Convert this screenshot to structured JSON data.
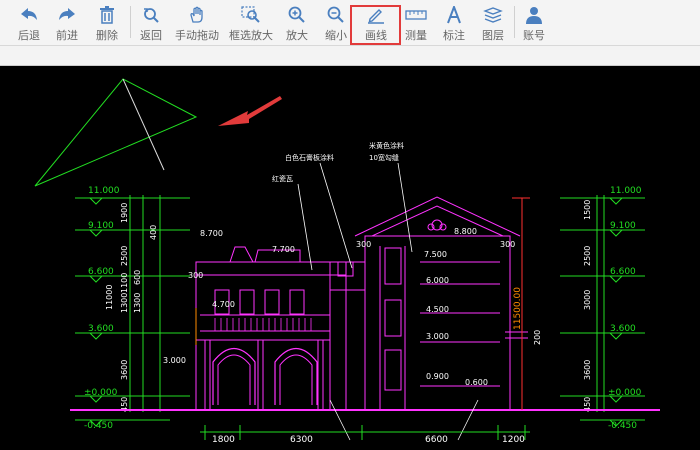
{
  "toolbar": {
    "items": [
      {
        "label": "后退",
        "icon": "arrow-left-icon"
      },
      {
        "label": "前进",
        "icon": "arrow-right-icon"
      },
      {
        "label": "删除",
        "icon": "trash-icon"
      },
      {
        "label": "返回",
        "icon": "zoom-back-icon"
      },
      {
        "label": "手动拖动",
        "icon": "hand-icon"
      },
      {
        "label": "框选放大",
        "icon": "box-zoom-icon"
      },
      {
        "label": "放大",
        "icon": "zoom-in-icon"
      },
      {
        "label": "缩小",
        "icon": "zoom-out-icon"
      },
      {
        "label": "画线",
        "icon": "pencil-icon"
      },
      {
        "label": "测量",
        "icon": "ruler-icon"
      },
      {
        "label": "标注",
        "icon": "text-a-icon"
      },
      {
        "label": "图层",
        "icon": "layers-icon"
      },
      {
        "label": "账号",
        "icon": "user-icon"
      }
    ],
    "highlighted": "画线",
    "highlight_color": "#e23b3b",
    "icon_color": "#4a7fbf"
  },
  "drawing": {
    "left_levels": [
      "11.000",
      "9.100",
      "6.600",
      "3.600",
      "±0.000",
      "-0.450"
    ],
    "right_levels": [
      "11.000",
      "9.100",
      "6.600",
      "3.600",
      "±0.000",
      "-0.450"
    ],
    "left_dims": [
      "1900",
      "2500",
      "1100",
      "1300",
      "1300",
      "600",
      "3600",
      "450",
      "11000",
      "3000"
    ],
    "right_dims": [
      "1500",
      "400",
      "2500",
      "3000",
      "3600",
      "450"
    ],
    "bottom_dims": [
      "1800",
      "6300",
      "6600",
      "1200"
    ],
    "elev_labels": [
      "8.700",
      "7.700",
      "8.800",
      "7.500",
      "6.000",
      "4.700",
      "4.500",
      "3.000",
      "3.000",
      "0.900",
      "0.600"
    ],
    "small_labels": [
      "300",
      "300",
      "300",
      "200"
    ],
    "notes": {
      "paint": "白色石膏板涂料",
      "tile": "红瓷瓦",
      "beige1": "米黄色涂料",
      "beige2": "10宽勾缝"
    },
    "vertical_dim": "11500.00",
    "colors": {
      "magenta": "#ff33ff",
      "green": "#22dd22",
      "white": "#ffffff",
      "red": "#ff3030",
      "orange": "#ff8c00"
    }
  }
}
